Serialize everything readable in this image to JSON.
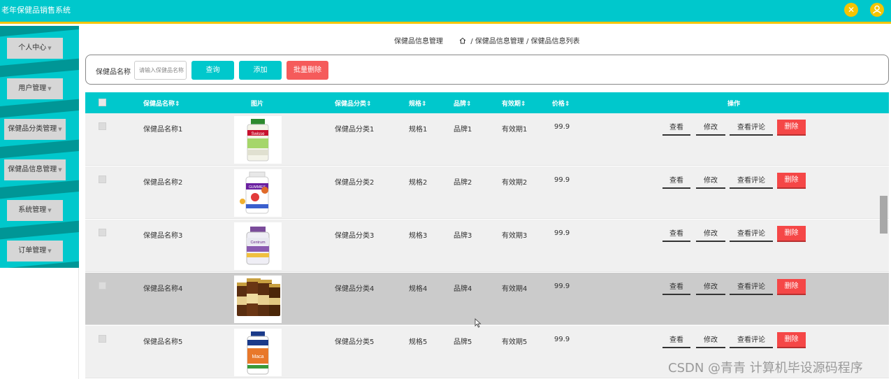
{
  "app": {
    "title": "老年保健品销售系统"
  },
  "header_icons": [
    "cross-icon",
    "user-icon"
  ],
  "sidebar": {
    "items": [
      {
        "label": "个人中心"
      },
      {
        "label": "用户管理"
      },
      {
        "label": "保健品分类管理"
      },
      {
        "label": "保健品信息管理"
      },
      {
        "label": "系统管理"
      },
      {
        "label": "订单管理"
      }
    ]
  },
  "breadcrumb": {
    "page_title": "保健品信息管理",
    "path": "/ 保健品信息管理 / 保健品信息列表"
  },
  "search": {
    "label": "保健品名称",
    "placeholder": "请输入保健品名称",
    "query_label": "查询",
    "add_label": "添加",
    "batch_delete_label": "批量删除"
  },
  "table": {
    "headers": {
      "name": "保健品名称⇕",
      "image": "图片",
      "category": "保健品分类⇕",
      "spec": "规格⇕",
      "brand": "品牌⇕",
      "expiry": "有效期⇕",
      "price": "价格⇕",
      "actions": "操作"
    },
    "rows": [
      {
        "name": "保健品名称1",
        "category": "保健品分类1",
        "spec": "规格1",
        "brand": "品牌1",
        "expiry": "有效期1",
        "price": "99.9",
        "image_label": "Swisse"
      },
      {
        "name": "保健品名称2",
        "category": "保健品分类2",
        "spec": "规格2",
        "brand": "品牌2",
        "expiry": "有效期2",
        "price": "99.9",
        "image_label": "GUMMIES"
      },
      {
        "name": "保健品名称3",
        "category": "保健品分类3",
        "spec": "规格3",
        "brand": "品牌3",
        "expiry": "有效期3",
        "price": "99.9",
        "image_label": "Centrum"
      },
      {
        "name": "保健品名称4",
        "category": "保健品分类4",
        "spec": "规格4",
        "brand": "品牌4",
        "expiry": "有效期4",
        "price": "99.9",
        "image_label": ""
      },
      {
        "name": "保健品名称5",
        "category": "保健品分类5",
        "spec": "规格5",
        "brand": "品牌5",
        "expiry": "有效期5",
        "price": "99.9",
        "image_label": "Maca"
      }
    ],
    "actions": {
      "view": "查看",
      "edit": "修改",
      "comments": "查看评论",
      "delete": "删除"
    }
  },
  "watermark": "CSDN @青青  计算机毕设源码程序",
  "colors": {
    "primary": "#00c8cc",
    "accent": "#f5c400",
    "sidebar_dark": "#009696",
    "danger": "#f54747",
    "row_highlight": "#cbcbcb"
  }
}
